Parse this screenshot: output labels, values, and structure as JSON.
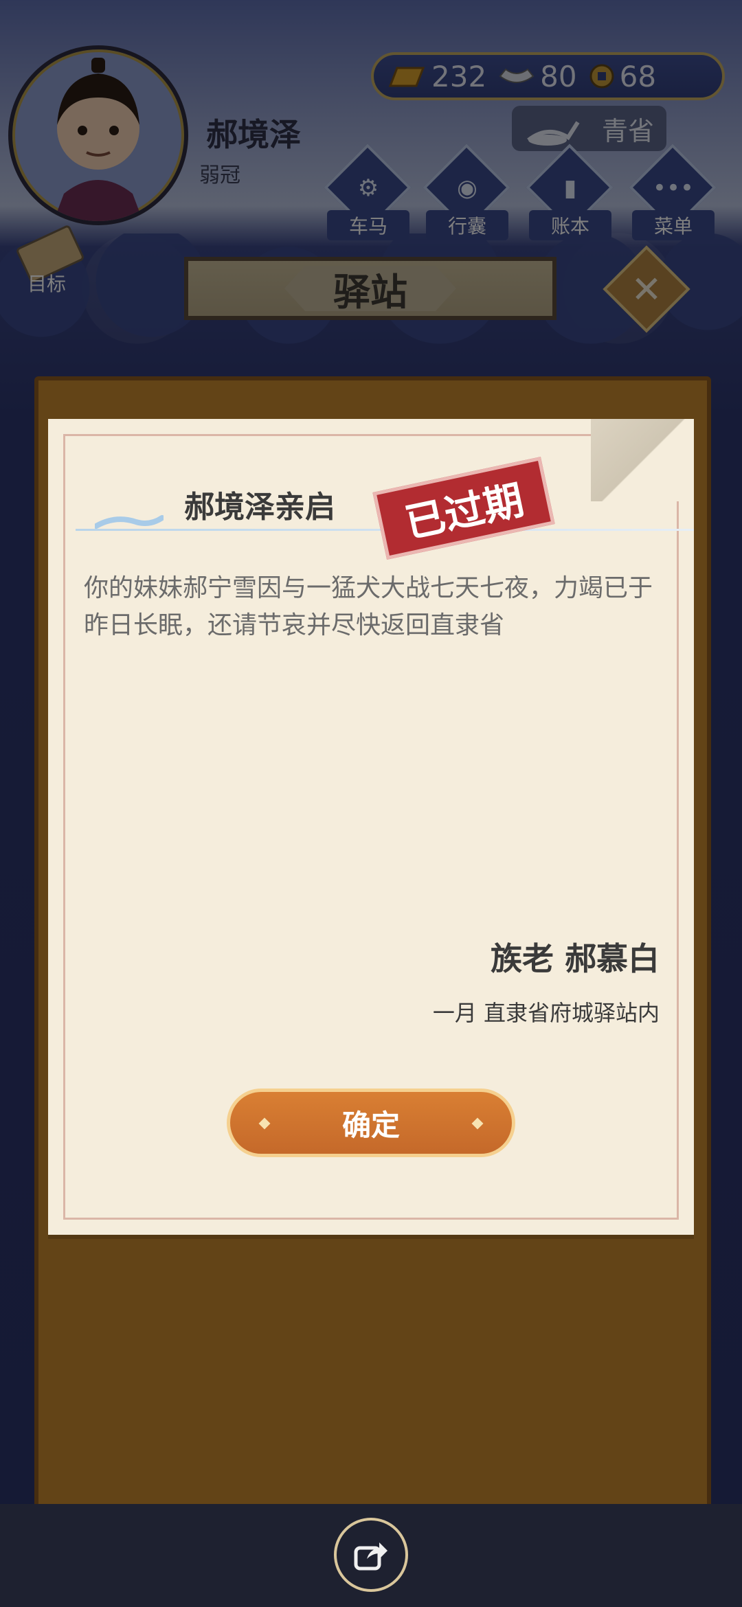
{
  "player": {
    "name": "郝境泽",
    "title": "弱冠"
  },
  "currency": {
    "gold": "232",
    "silver": "80",
    "coins": "68"
  },
  "location": {
    "label": "青省"
  },
  "menu": [
    {
      "label": "车马",
      "icon": "carriage-icon"
    },
    {
      "label": "行囊",
      "icon": "bag-icon"
    },
    {
      "label": "账本",
      "icon": "ledger-icon"
    },
    {
      "label": "菜单",
      "icon": "more-icon"
    }
  ],
  "goal": {
    "label": "目标"
  },
  "station": {
    "title": "驿站"
  },
  "letter": {
    "recipient": "郝境泽亲启",
    "stamp": "已过期",
    "body": "你的妹妹郝宁雪因与一猛犬大战七天七夜，力竭已于昨日长眠，还请节哀并尽快返回直隶省",
    "sender": "族老 郝慕白",
    "place_date": "一月 直隶省府城驿站内",
    "confirm": "确定"
  },
  "colors": {
    "primary_blue": "#3b4a8c",
    "gold_border": "#c7ad62",
    "stamp_red": "#b22c31",
    "button_orange": "#d97f33",
    "parchment": "#f5eddc"
  }
}
